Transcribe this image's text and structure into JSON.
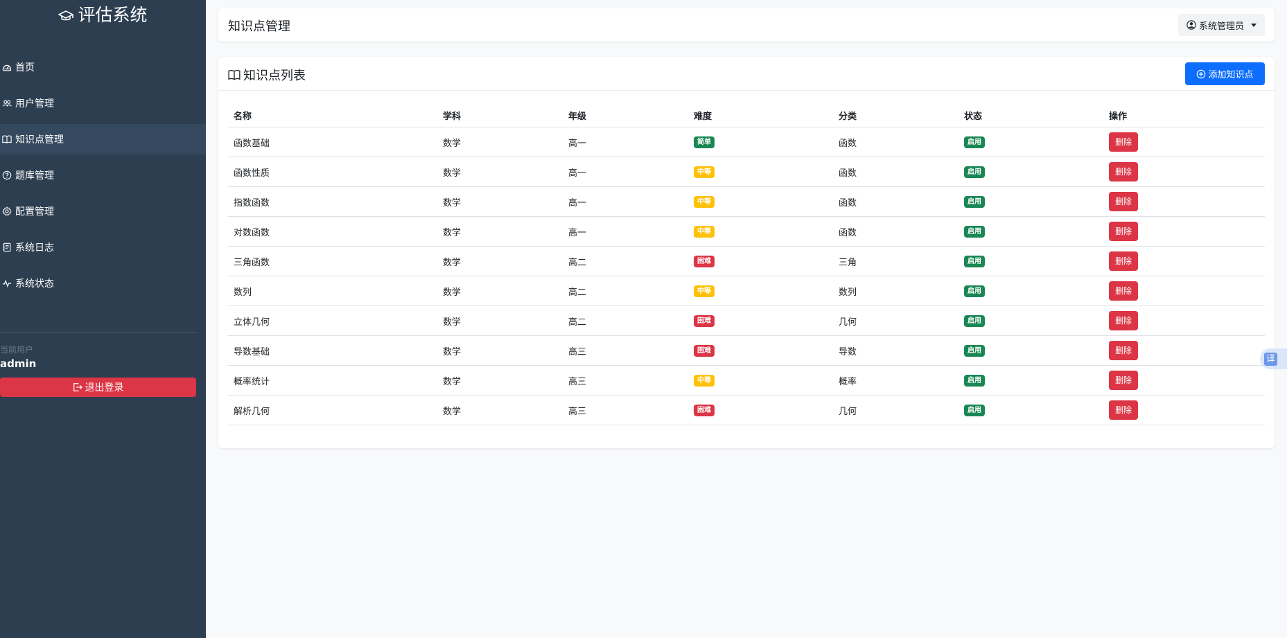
{
  "sidebar": {
    "brand": "评估系统",
    "nav": [
      {
        "label": "首页",
        "icon": "dashboard-icon"
      },
      {
        "label": "用户管理",
        "icon": "users-icon"
      },
      {
        "label": "知识点管理",
        "icon": "book-icon"
      },
      {
        "label": "题库管理",
        "icon": "question-circle-icon"
      },
      {
        "label": "配置管理",
        "icon": "gear-icon"
      },
      {
        "label": "系统日志",
        "icon": "journal-icon"
      },
      {
        "label": "系统状态",
        "icon": "activity-icon"
      }
    ],
    "current_user_label": "当前用户",
    "current_user": "admin",
    "logout_label": "退出登录"
  },
  "header": {
    "title": "知识点管理",
    "user_menu_label": "系统管理员"
  },
  "card": {
    "title": "知识点列表",
    "add_label": "添加知识点"
  },
  "table": {
    "headers": [
      "名称",
      "学科",
      "年级",
      "难度",
      "分类",
      "状态",
      "操作"
    ],
    "rows": [
      {
        "name": "函数基础",
        "subject": "数学",
        "grade": "高一",
        "difficulty": "简单",
        "category": "函数",
        "status": "启用",
        "action": "删除"
      },
      {
        "name": "函数性质",
        "subject": "数学",
        "grade": "高一",
        "difficulty": "中等",
        "category": "函数",
        "status": "启用",
        "action": "删除"
      },
      {
        "name": "指数函数",
        "subject": "数学",
        "grade": "高一",
        "difficulty": "中等",
        "category": "函数",
        "status": "启用",
        "action": "删除"
      },
      {
        "name": "对数函数",
        "subject": "数学",
        "grade": "高一",
        "difficulty": "中等",
        "category": "函数",
        "status": "启用",
        "action": "删除"
      },
      {
        "name": "三角函数",
        "subject": "数学",
        "grade": "高二",
        "difficulty": "困难",
        "category": "三角",
        "status": "启用",
        "action": "删除"
      },
      {
        "name": "数列",
        "subject": "数学",
        "grade": "高二",
        "difficulty": "中等",
        "category": "数列",
        "status": "启用",
        "action": "删除"
      },
      {
        "name": "立体几何",
        "subject": "数学",
        "grade": "高二",
        "difficulty": "困难",
        "category": "几何",
        "status": "启用",
        "action": "删除"
      },
      {
        "name": "导数基础",
        "subject": "数学",
        "grade": "高三",
        "difficulty": "困难",
        "category": "导数",
        "status": "启用",
        "action": "删除"
      },
      {
        "name": "概率统计",
        "subject": "数学",
        "grade": "高三",
        "difficulty": "中等",
        "category": "概率",
        "status": "启用",
        "action": "删除"
      },
      {
        "name": "解析几何",
        "subject": "数学",
        "grade": "高三",
        "difficulty": "困难",
        "category": "几何",
        "status": "启用",
        "action": "删除"
      }
    ]
  },
  "colors": {
    "sidebar_bg": "#2c3e50",
    "primary": "#0d6efd",
    "danger": "#dc3545",
    "success": "#198754",
    "warning": "#ffc107"
  },
  "translate_label": "译"
}
